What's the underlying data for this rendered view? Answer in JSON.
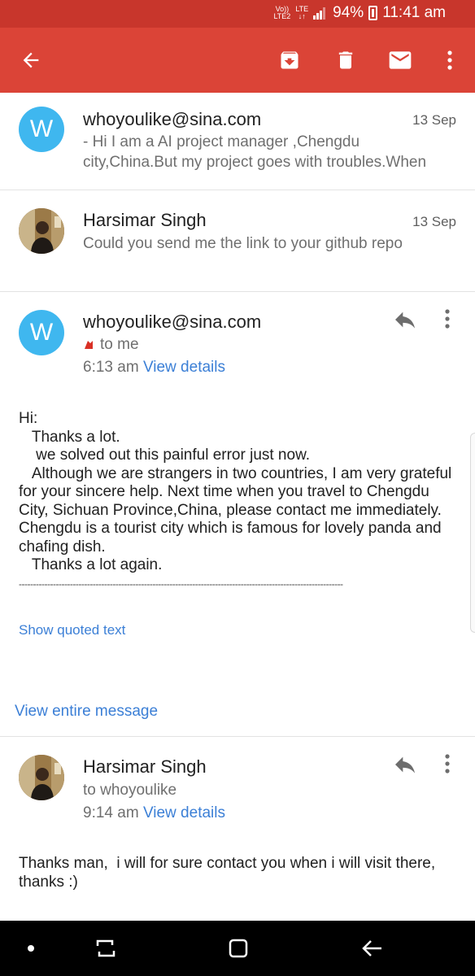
{
  "status_bar": {
    "volte": "Vo))",
    "lte2": "LTE2",
    "lte": "LTE",
    "battery": "94%",
    "time": "11:41 am"
  },
  "toolbar": {
    "icons": [
      "back-arrow-icon",
      "archive-icon",
      "delete-icon",
      "mark-unread-icon",
      "more-vert-icon"
    ],
    "color": "#db4437"
  },
  "thread": [
    {
      "sender": "whoyoulike@sina.com",
      "date": "13 Sep",
      "avatar_letter": "W",
      "snippet": "- Hi I am a AI project manager ,Chengdu city,China.But my project goes with troubles.When"
    },
    {
      "sender": "Harsimar Singh",
      "date": "13 Sep",
      "snippet": "Could you send me the link to your github repo"
    }
  ],
  "message1": {
    "avatar_letter": "W",
    "sender": "whoyoulike@sina.com",
    "recipient": "to me",
    "time": "6:13 am",
    "view_details": "View details",
    "body": "Hi:\n   Thanks a lot.\n    we solved out this painful error just now.\n   Although we are strangers in two countries, I am very grateful for your sincere help. Next time when you travel to Chengdu City, Sichuan Province,China, please contact me immediately. Chengdu is a tourist city which is famous for lovely panda and chafing dish.\n   Thanks a lot again.",
    "divider": "------------------------------------------------------------------------------------------------------------------",
    "show_quoted": "Show quoted text",
    "view_entire": "View entire message"
  },
  "message2": {
    "sender": "Harsimar Singh",
    "recipient": "to whoyoulike",
    "time": "9:14 am",
    "view_details": "View details",
    "body": "Thanks man,  i will for sure contact you when i will visit there, thanks :)"
  },
  "nav_bar": {
    "icons": [
      "dot-icon",
      "recent-apps-icon",
      "home-icon",
      "back-icon"
    ]
  },
  "colors": {
    "accent": "#db4437",
    "status_bar": "#c8362c",
    "avatar": "#3fb7ef",
    "link": "#3b7fd6"
  }
}
